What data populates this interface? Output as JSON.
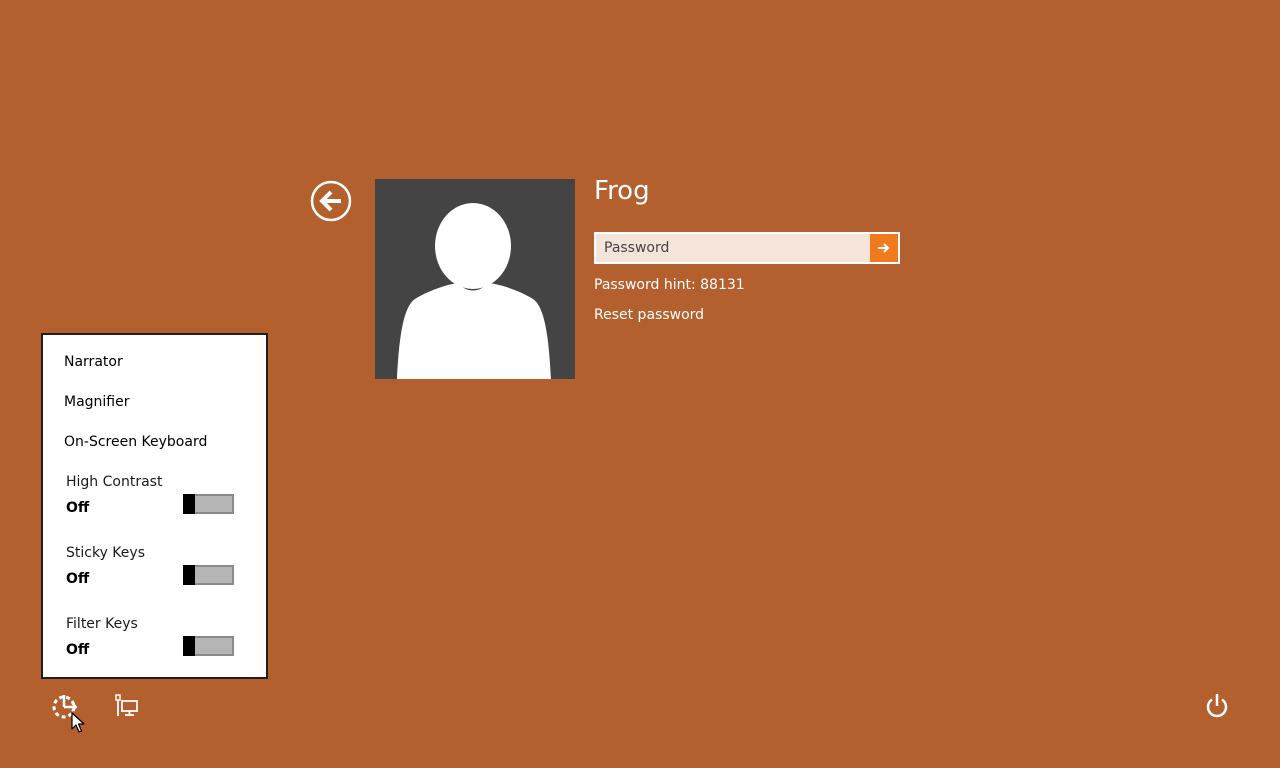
{
  "screen": {
    "background_color": "#b4602e",
    "accent_color": "#f07a1d"
  },
  "signin": {
    "back_icon": "back-arrow-circle-icon",
    "avatar_icon": "default-user-silhouette-icon",
    "username": "Frog",
    "password_placeholder": "Password",
    "password_value": "",
    "submit_icon": "arrow-right-icon",
    "password_hint": "Password hint: 88131",
    "reset_password_label": "Reset password"
  },
  "ease_menu": {
    "items": [
      {
        "label": "Narrator"
      },
      {
        "label": "Magnifier"
      },
      {
        "label": "On-Screen Keyboard"
      }
    ],
    "toggles": [
      {
        "title": "High Contrast",
        "state": "Off",
        "on": false
      },
      {
        "title": "Sticky Keys",
        "state": "Off",
        "on": false
      },
      {
        "title": "Filter Keys",
        "state": "Off",
        "on": false
      }
    ]
  },
  "bottom_bar": {
    "ease_of_access_icon": "ease-of-access-icon",
    "network_icon": "network-icon",
    "power_icon": "power-icon"
  }
}
